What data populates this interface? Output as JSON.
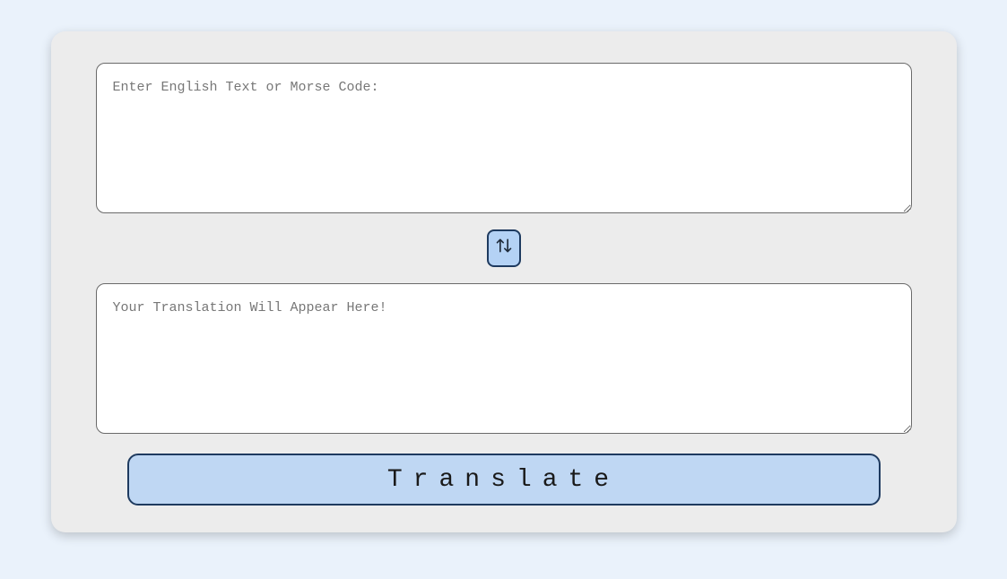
{
  "input": {
    "placeholder": "Enter English Text or Morse Code:",
    "value": ""
  },
  "output": {
    "placeholder": "Your Translation Will Appear Here!",
    "value": ""
  },
  "swap_icon": "swap-vertical",
  "translate_button_label": "Translate"
}
